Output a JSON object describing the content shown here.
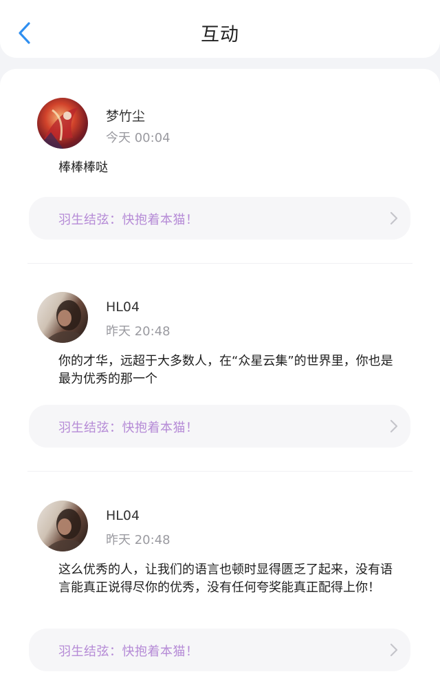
{
  "header": {
    "title": "互动",
    "back_icon": "chevron-left-icon"
  },
  "colors": {
    "accent": "#2f8ff0",
    "reply_text": "#b58ad6",
    "timestamp": "#9a9aa0"
  },
  "interactions": [
    {
      "username": "梦竹尘",
      "time": "今天 00:04",
      "comment": "棒棒棒哒",
      "reply": "羽生结弦：快抱着本猫！"
    },
    {
      "username": "HL04",
      "time": "昨天 20:48",
      "comment": "你的才华，远超于大多数人，在“众星云集”的世界里，你也是最为优秀的那一个",
      "reply": "羽生结弦：快抱着本猫！"
    },
    {
      "username": "HL04",
      "time": "昨天 20:48",
      "comment": "这么优秀的人，让我们的语言也顿时显得匮乏了起来，没有语言能真正说得尽你的优秀，没有任何夸奖能真正配得上你！",
      "reply": "羽生结弦：快抱着本猫！"
    }
  ]
}
